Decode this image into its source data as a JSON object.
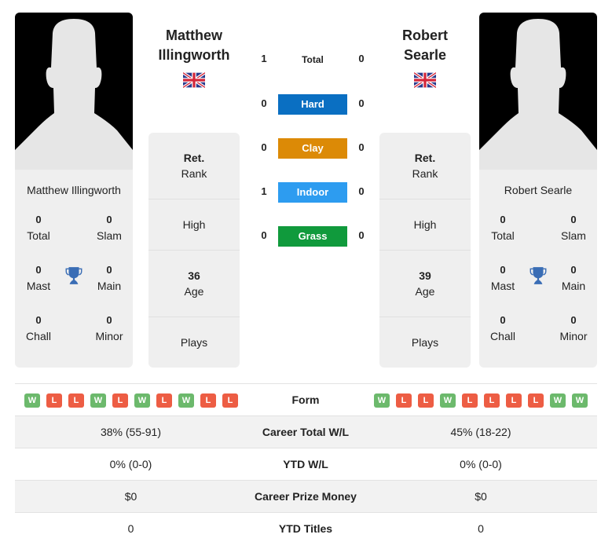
{
  "players": [
    {
      "name_line1": "Matthew",
      "name_line2": "Illingworth",
      "full_name": "Matthew Illingworth",
      "flag": "uk-flag",
      "titles": {
        "total": {
          "value": "0",
          "label": "Total"
        },
        "slam": {
          "value": "0",
          "label": "Slam"
        },
        "mast": {
          "value": "0",
          "label": "Mast"
        },
        "main": {
          "value": "0",
          "label": "Main"
        },
        "chall": {
          "value": "0",
          "label": "Chall"
        },
        "minor": {
          "value": "0",
          "label": "Minor"
        }
      },
      "info": {
        "rank_value": "Ret.",
        "rank_label": "Rank",
        "high_label": "High",
        "age_value": "36",
        "age_label": "Age",
        "plays_label": "Plays"
      },
      "form": [
        "W",
        "L",
        "L",
        "W",
        "L",
        "W",
        "L",
        "W",
        "L",
        "L"
      ]
    },
    {
      "name_line1": "Robert",
      "name_line2": "Searle",
      "full_name": "Robert Searle",
      "flag": "uk-flag",
      "titles": {
        "total": {
          "value": "0",
          "label": "Total"
        },
        "slam": {
          "value": "0",
          "label": "Slam"
        },
        "mast": {
          "value": "0",
          "label": "Mast"
        },
        "main": {
          "value": "0",
          "label": "Main"
        },
        "chall": {
          "value": "0",
          "label": "Chall"
        },
        "minor": {
          "value": "0",
          "label": "Minor"
        }
      },
      "info": {
        "rank_value": "Ret.",
        "rank_label": "Rank",
        "high_label": "High",
        "age_value": "39",
        "age_label": "Age",
        "plays_label": "Plays"
      },
      "form": [
        "W",
        "L",
        "L",
        "W",
        "L",
        "L",
        "L",
        "L",
        "W",
        "W"
      ]
    }
  ],
  "h2h": [
    {
      "label": "Total",
      "p1": "1",
      "p2": "0",
      "color": ""
    },
    {
      "label": "Hard",
      "p1": "0",
      "p2": "0",
      "color": "#0a6fc2"
    },
    {
      "label": "Clay",
      "p1": "0",
      "p2": "0",
      "color": "#dc8a06"
    },
    {
      "label": "Indoor",
      "p1": "1",
      "p2": "0",
      "color": "#2d9cf0"
    },
    {
      "label": "Grass",
      "p1": "0",
      "p2": "0",
      "color": "#109a3c"
    }
  ],
  "stats": [
    {
      "label": "Form",
      "p1": "",
      "p2": ""
    },
    {
      "label": "Career Total W/L",
      "p1": "38% (55-91)",
      "p2": "45% (18-22)"
    },
    {
      "label": "YTD W/L",
      "p1": "0% (0-0)",
      "p2": "0% (0-0)"
    },
    {
      "label": "Career Prize Money",
      "p1": "$0",
      "p2": "$0"
    },
    {
      "label": "YTD Titles",
      "p1": "0",
      "p2": "0"
    }
  ],
  "colors": {
    "win": "#6cb96c",
    "loss": "#ed5d44",
    "trophy": "#3a6db5",
    "card_bg": "#efefef"
  }
}
